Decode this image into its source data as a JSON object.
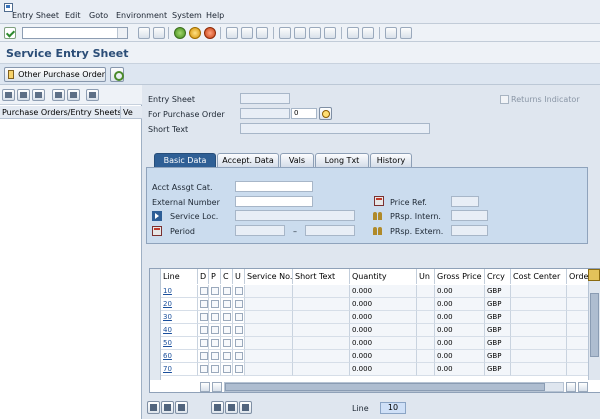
{
  "menu": [
    "Entry Sheet",
    "Edit",
    "Goto",
    "Environment",
    "System",
    "Help"
  ],
  "page_title": "Service Entry Sheet",
  "app_toolbar": {
    "other_po_label": "Other Purchase Order"
  },
  "left_pane": {
    "col1": "Purchase Orders/Entry Sheets",
    "col2": "Ve"
  },
  "header_fields": {
    "entry_sheet_label": "Entry Sheet",
    "for_po_label": "For Purchase Order",
    "for_po_item": "0",
    "short_text_label": "Short Text",
    "returns_label": "Returns Indicator"
  },
  "tabs": [
    "Basic Data",
    "Accept. Data",
    "Vals",
    "Long Txt",
    "History"
  ],
  "basic_data": {
    "acct_assgt_label": "Acct Assgt Cat.",
    "external_number_label": "External Number",
    "service_loc_label": "Service Loc.",
    "period_label": "Period",
    "period_sep": "–",
    "price_ref_label": "Price Ref.",
    "prsp_intern_label": "PRsp. Intern.",
    "prsp_extern_label": "PRsp. Extern."
  },
  "table": {
    "columns": [
      "Line",
      "D",
      "P",
      "C",
      "U",
      "Service No.",
      "Short Text",
      "Quantity",
      "Un",
      "Gross Price",
      "Crcy",
      "Cost Center",
      "Orde"
    ],
    "rows": [
      {
        "line": "10",
        "quantity": "0.000",
        "gross_price": "0.00",
        "crcy": "GBP"
      },
      {
        "line": "20",
        "quantity": "0.000",
        "gross_price": "0.00",
        "crcy": "GBP"
      },
      {
        "line": "30",
        "quantity": "0.000",
        "gross_price": "0.00",
        "crcy": "GBP"
      },
      {
        "line": "40",
        "quantity": "0.000",
        "gross_price": "0.00",
        "crcy": "GBP"
      },
      {
        "line": "50",
        "quantity": "0.000",
        "gross_price": "0.00",
        "crcy": "GBP"
      },
      {
        "line": "60",
        "quantity": "0.000",
        "gross_price": "0.00",
        "crcy": "GBP"
      },
      {
        "line": "70",
        "quantity": "0.000",
        "gross_price": "0.00",
        "crcy": "GBP"
      }
    ]
  },
  "bottom": {
    "line_label": "Line",
    "line_value": "10"
  }
}
